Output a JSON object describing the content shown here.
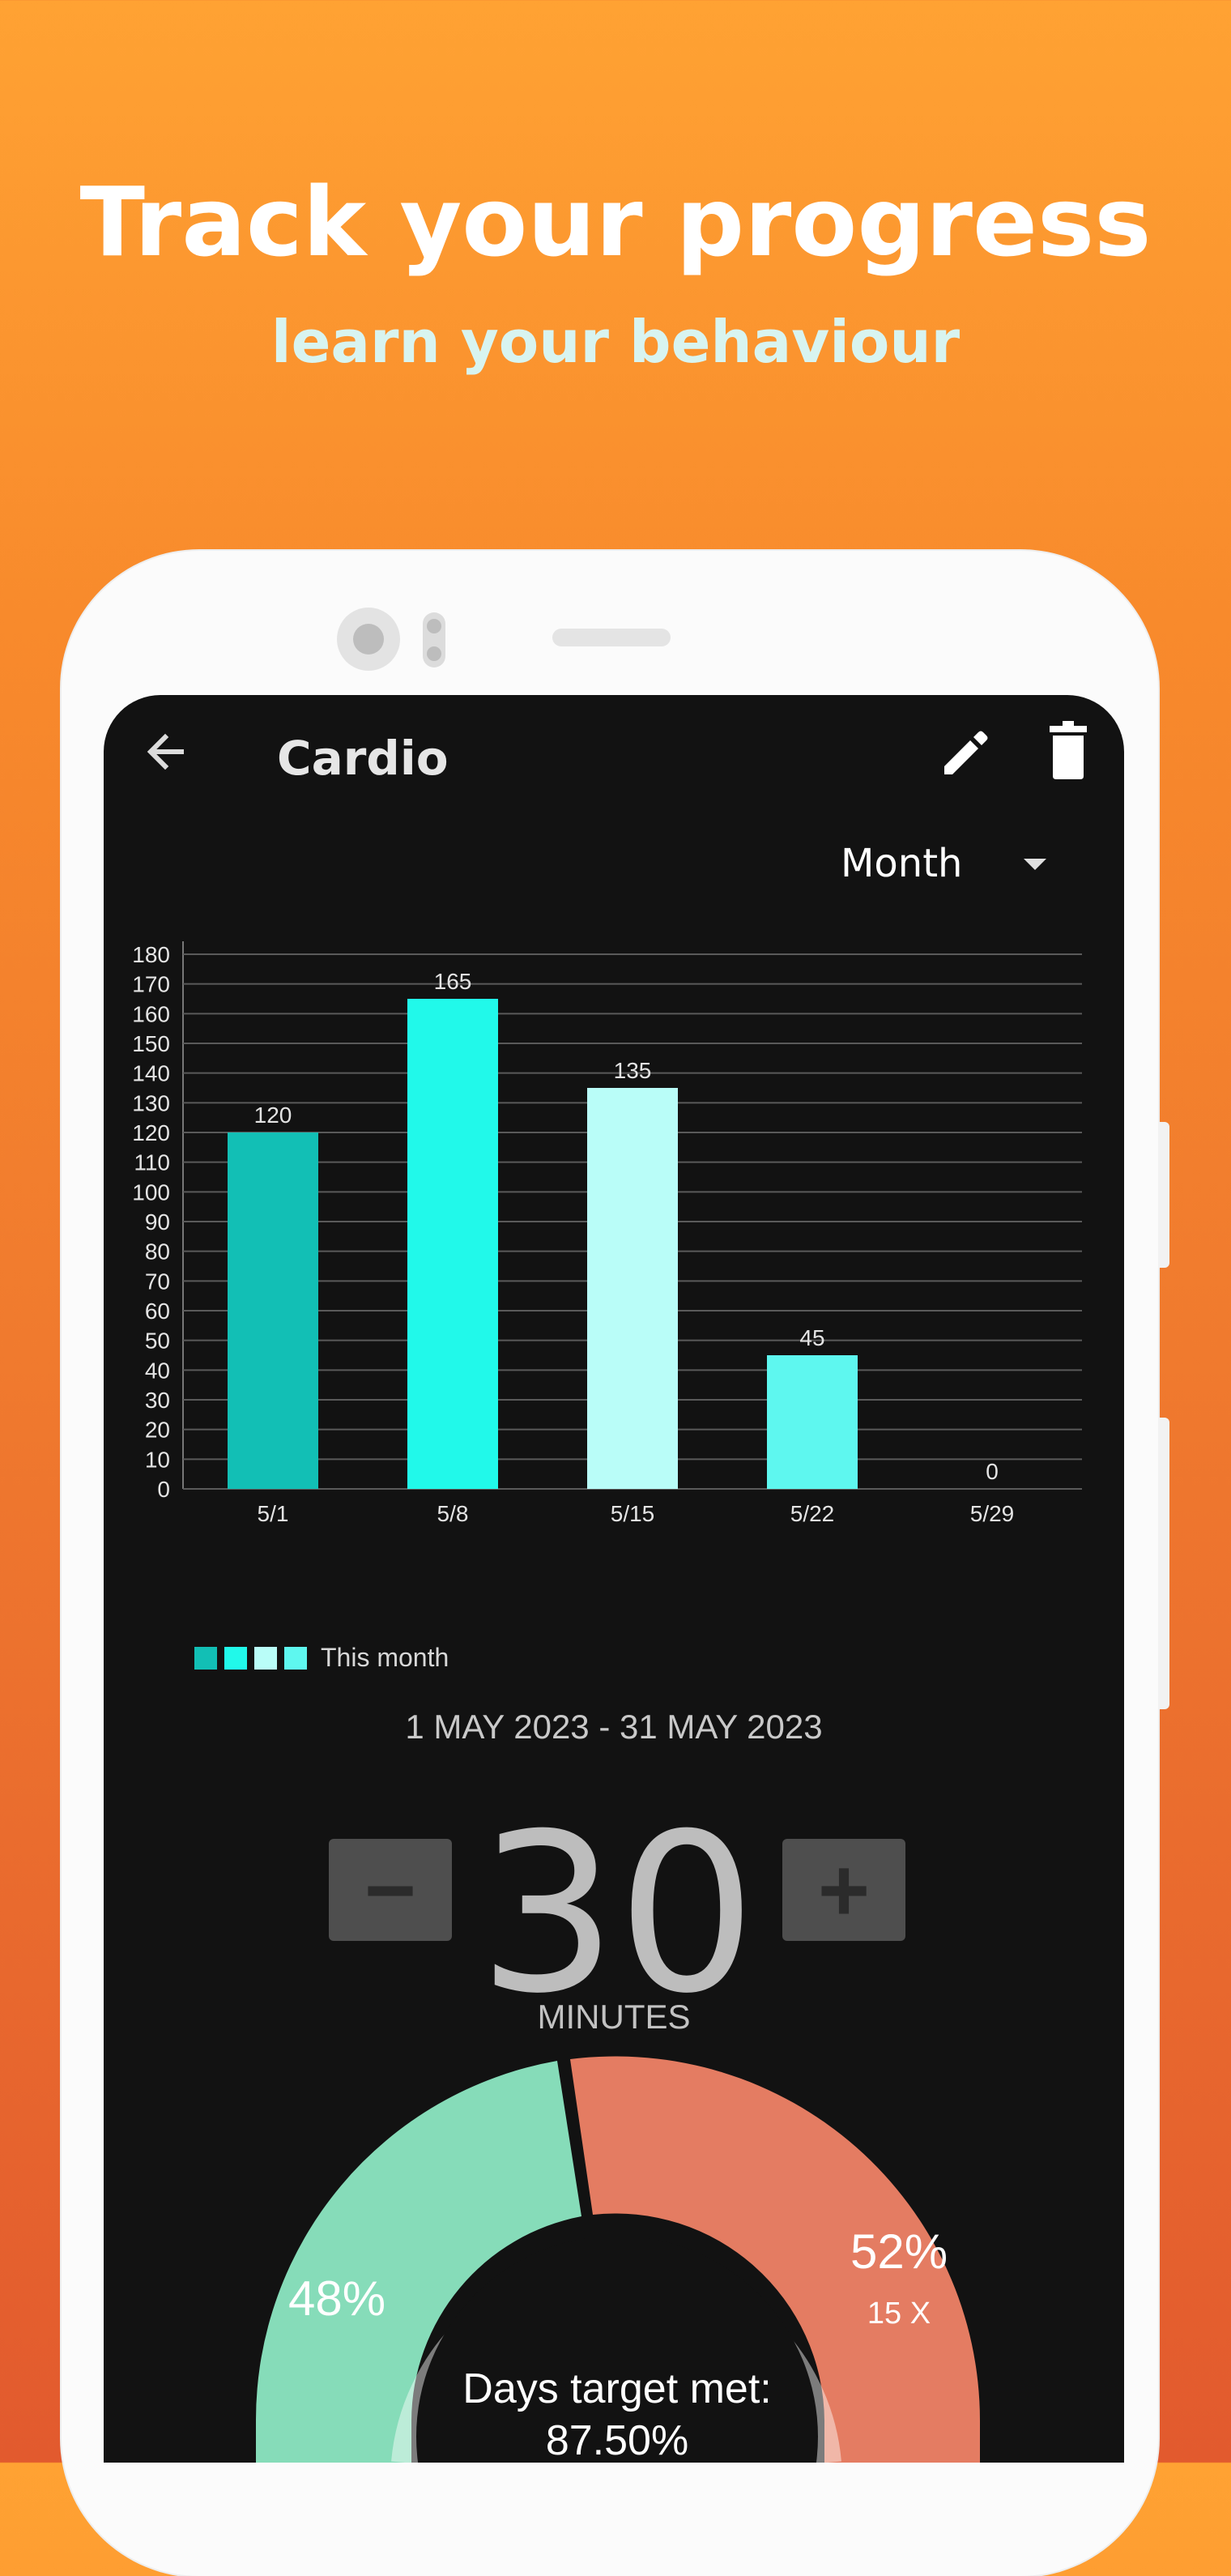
{
  "promo": {
    "headline": "Track your progress",
    "subline": "learn your behaviour"
  },
  "appbar": {
    "title": "Cardio",
    "back_icon": "arrow-left-icon",
    "edit_icon": "pencil-icon",
    "delete_icon": "trash-icon"
  },
  "period": {
    "selected": "Month"
  },
  "chart_data": {
    "type": "bar",
    "categories": [
      "5/1",
      "5/8",
      "5/15",
      "5/22",
      "5/29"
    ],
    "values": [
      120,
      165,
      135,
      45,
      0
    ],
    "colors": [
      "#12bfb5",
      "#21f9ea",
      "#b9fdf8",
      "#5ef7ef",
      "#5ef7ef"
    ],
    "ylim": [
      0,
      180
    ],
    "yticks": [
      0,
      10,
      20,
      30,
      40,
      50,
      60,
      70,
      80,
      90,
      100,
      110,
      120,
      130,
      140,
      150,
      160,
      170,
      180
    ],
    "grid": true,
    "legend": {
      "label": "This month",
      "colors": [
        "#12bfb5",
        "#21f9ea",
        "#b9fdf8",
        "#5ef7ef"
      ],
      "placement": "bottom-left"
    }
  },
  "date_range": "1 MAY 2023 - 31 MAY 2023",
  "target": {
    "minus_label": "−",
    "plus_label": "+",
    "value": "30",
    "unit": "MINUTES"
  },
  "donut": {
    "center_line1": "Days target met:",
    "center_line2": "87.50%",
    "met_percent": "48%",
    "missed_percent": "52%",
    "missed_count": "15 X",
    "met_color": "#86dcb9",
    "missed_color": "#e47c62"
  }
}
